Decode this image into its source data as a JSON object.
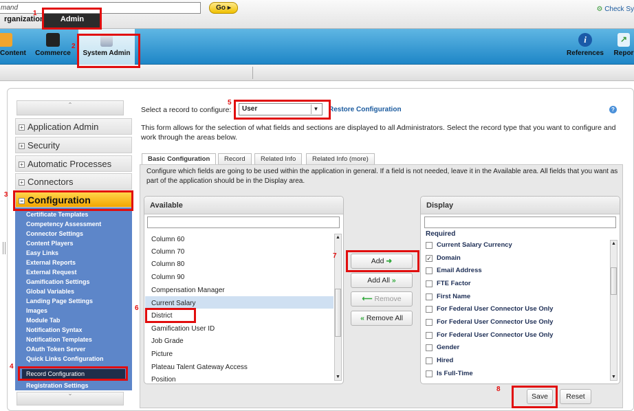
{
  "top_tabs": [
    {
      "label": "rganization"
    },
    {
      "label": "Admin"
    }
  ],
  "check_system": "Check Sy",
  "ribbon": {
    "left": [
      {
        "label": "Content",
        "icon": "content-icon"
      },
      {
        "label": "Commerce",
        "icon": "commerce-icon"
      },
      {
        "label": "System Admin",
        "icon": "system-admin-icon"
      }
    ],
    "right": [
      {
        "label": "References",
        "icon": "info-icon"
      },
      {
        "label": "Repor",
        "icon": "reports-icon"
      }
    ]
  },
  "command": {
    "value": "mand",
    "go_label": "Go"
  },
  "left_nav": {
    "sections": [
      {
        "label": "Application Admin"
      },
      {
        "label": "Security"
      },
      {
        "label": "Automatic Processes"
      },
      {
        "label": "Connectors"
      },
      {
        "label": "Configuration"
      }
    ],
    "submenu": [
      "Certificate Templates",
      "Competency Assessment",
      "Connector Settings",
      "Content Players",
      "Easy Links",
      "External Reports",
      "External Request",
      "Gamification Settings",
      "Global Variables",
      "Landing Page Settings",
      "Images",
      "Module Tab",
      "Notification Syntax",
      "Notification Templates",
      "OAuth Token Server",
      "Quick Links Configuration",
      "Record Configuration",
      "Registration Settings"
    ],
    "selected_item": "Record Configuration"
  },
  "form": {
    "select_label": "Select a record to configure:",
    "selected_record": "User",
    "restore_link": "Restore Configuration",
    "description": "This form allows for the selection of what fields and sections are displayed to all Administrators.  Select the record type that you want to configure and work through the areas below.",
    "tabs": [
      "Basic Configuration",
      "Record",
      "Related Info",
      "Related Info (more)"
    ],
    "tab_description": "Configure which fields are going to be used within the application in general. If a field is not needed, leave it in the Available area. All fields that you want as part of the application should be in the Display area."
  },
  "available": {
    "title": "Available",
    "filter_value": "",
    "items": [
      "Column 60",
      "Column 70",
      "Column 80",
      "Column 90",
      "Compensation Manager",
      "Current Salary",
      "District",
      "Gamification User ID",
      "Job Grade",
      "Picture",
      "Plateau Talent Gateway Access",
      "Position"
    ],
    "highlighted": "Current Salary"
  },
  "buttons": {
    "add": "Add",
    "add_all": "Add All",
    "remove": "Remove",
    "remove_all": "Remove All",
    "save": "Save",
    "reset": "Reset"
  },
  "display": {
    "title": "Display",
    "filter_value": "",
    "group_label": "Required",
    "items": [
      {
        "label": "Current Salary Currency",
        "checked": false
      },
      {
        "label": "Domain",
        "checked": true
      },
      {
        "label": "Email Address",
        "checked": false
      },
      {
        "label": "FTE Factor",
        "checked": false
      },
      {
        "label": "First Name",
        "checked": false
      },
      {
        "label": "For Federal User Connector Use Only",
        "checked": false
      },
      {
        "label": "For Federal User Connector Use Only",
        "checked": false
      },
      {
        "label": "For Federal User Connector Use Only",
        "checked": false
      },
      {
        "label": "Gender",
        "checked": false
      },
      {
        "label": "Hired",
        "checked": false
      },
      {
        "label": "Is Full-Time",
        "checked": false
      }
    ]
  },
  "annotations": [
    "1",
    "2",
    "3",
    "4",
    "5",
    "6",
    "7",
    "8"
  ],
  "colors": {
    "annotation": "#e10d0d",
    "ribbon": "#2a95d2",
    "nav_submenu": "#5d86c9",
    "nav_active": "#f3a600",
    "link": "#1a5a9e"
  }
}
